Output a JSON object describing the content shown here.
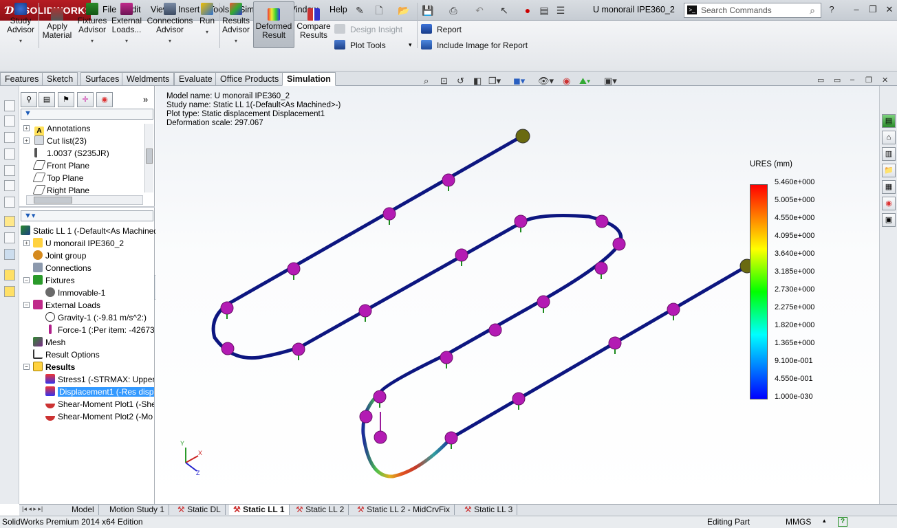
{
  "app": {
    "logo_text": "SOLIDWORKS",
    "doc_title": "U monorail IPE360_2"
  },
  "menu": [
    "File",
    "Edit",
    "View",
    "Insert",
    "Tools",
    "Simulation",
    "Window",
    "Help"
  ],
  "search": {
    "placeholder": "Search Commands"
  },
  "commands": {
    "study_advisor": [
      "Study",
      "Advisor"
    ],
    "apply_material": [
      "Apply",
      "Material"
    ],
    "fixtures_advisor": [
      "Fixtures",
      "Advisor"
    ],
    "external_loads": [
      "External",
      "Loads..."
    ],
    "connections_advisor": [
      "Connections",
      "Advisor"
    ],
    "run": "Run",
    "results_advisor": [
      "Results",
      "Advisor"
    ],
    "deformed_result": [
      "Deformed",
      "Result"
    ],
    "compare_results": [
      "Compare",
      "Results"
    ],
    "design_insight": "Design Insight",
    "plot_tools": "Plot Tools",
    "report": "Report",
    "include_image": "Include Image for Report"
  },
  "tabs": [
    "Features",
    "Sketch",
    "Surfaces",
    "Weldments",
    "Evaluate",
    "Office Products",
    "Simulation"
  ],
  "active_tab": "Simulation",
  "tree_top": [
    {
      "label": "Annotations"
    },
    {
      "label": "Cut list(23)"
    },
    {
      "label": "1.0037 (S235JR)"
    },
    {
      "label": "Front Plane"
    },
    {
      "label": "Top Plane"
    },
    {
      "label": "Right Plane"
    }
  ],
  "tree_sim": {
    "study": "Static LL 1 (-Default<As Machined",
    "part": "U monorail IPE360_2",
    "joint_group": "Joint group",
    "connections": "Connections",
    "fixtures": "Fixtures",
    "immovable": "Immovable-1",
    "external_loads": "External Loads",
    "gravity": "Gravity-1 (:-9.81 m/s^2:)",
    "force": "Force-1 (:Per item: -42673.",
    "mesh": "Mesh",
    "result_options": "Result Options",
    "results": "Results",
    "stress": "Stress1 (-STRMAX: Upper b",
    "displacement": "Displacement1 (-Res disp",
    "shear1": "Shear-Moment Plot1 (-She",
    "shear2": "Shear-Moment Plot2 (-Mo"
  },
  "plot_info": {
    "model": "Model name: U monorail IPE360_2",
    "study": "Study name: Static LL 1(-Default<As Machined>-)",
    "type": "Plot type: Static displacement Displacement1",
    "scale": "Deformation scale: 297.067"
  },
  "legend": {
    "title": "URES (mm)",
    "values": [
      "5.460e+000",
      "5.005e+000",
      "4.550e+000",
      "4.095e+000",
      "3.640e+000",
      "3.185e+000",
      "2.730e+000",
      "2.275e+000",
      "1.820e+000",
      "1.365e+000",
      "9.100e-001",
      "4.550e-001",
      "1.000e-030"
    ]
  },
  "triad": {
    "x": "X",
    "y": "Y",
    "z": "Z"
  },
  "bottom_tabs": [
    "Model",
    "Motion Study 1",
    "Static DL",
    "Static LL 1",
    "Static LL 2",
    "Static LL 2 - MidCrvFix",
    "Static LL 3"
  ],
  "active_bottom_tab": "Static LL 1",
  "status": {
    "edition": "SolidWorks Premium 2014 x64 Edition",
    "mode": "Editing Part",
    "units": "MMGS"
  },
  "colors": {
    "beam": "#0d1680",
    "support": "#b31bb3",
    "legend_max": "#ff0000",
    "legend_min": "#0000ff",
    "accent": "#3399ff"
  }
}
